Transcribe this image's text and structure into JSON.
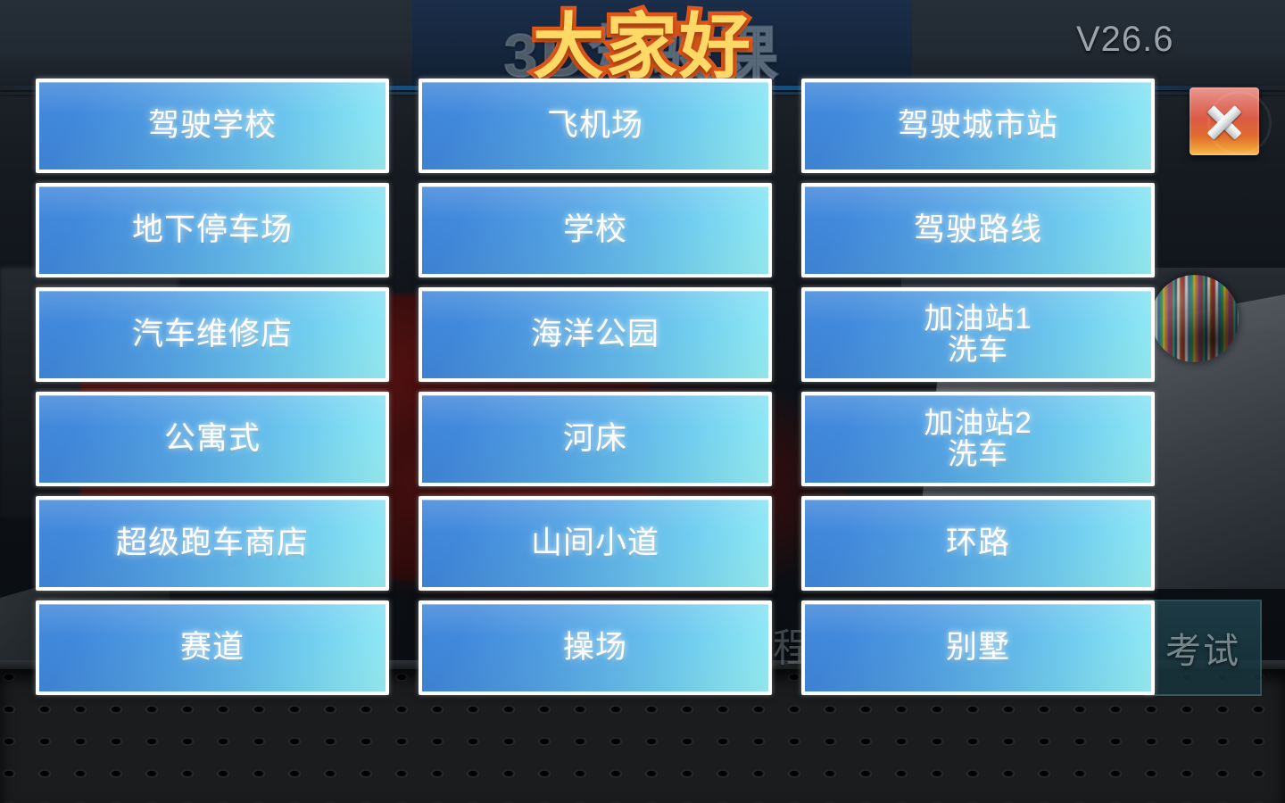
{
  "app": {
    "background_title": "3D驾驶课",
    "overlay_text": "大家好",
    "version": "V26.6"
  },
  "colors": {
    "button_gradient_start": "#3f86da",
    "button_gradient_end": "#9bf0f6",
    "button_border": "#ffffff",
    "overlay_text_fill": "#ffd966",
    "overlay_text_stroke": "#e2571b",
    "version_text": "#9aa3ab",
    "close_button_top": "#e8988f",
    "close_button_bottom": "#f6c05c",
    "background_dark": "#10141a"
  },
  "close_button": {
    "name": "close-icon",
    "label": "✕"
  },
  "background_elements": {
    "language_globe": "flag-globe-icon",
    "ghost_button_label": "考试",
    "ghost_char": "程"
  },
  "menu": {
    "columns": 3,
    "rows": 6,
    "buttons": [
      {
        "id": "driving-school",
        "label": "驾驶学校",
        "line2": "",
        "col": 1,
        "row": 1
      },
      {
        "id": "airport",
        "label": "飞机场",
        "line2": "",
        "col": 2,
        "row": 1
      },
      {
        "id": "driving-city-station",
        "label": "驾驶城市站",
        "line2": "",
        "col": 3,
        "row": 1
      },
      {
        "id": "underground-parking",
        "label": "地下停车场",
        "line2": "",
        "col": 1,
        "row": 2
      },
      {
        "id": "school",
        "label": "学校",
        "line2": "",
        "col": 2,
        "row": 2
      },
      {
        "id": "driving-route",
        "label": "驾驶路线",
        "line2": "",
        "col": 3,
        "row": 2
      },
      {
        "id": "auto-repair-shop",
        "label": "汽车维修店",
        "line2": "",
        "col": 1,
        "row": 3
      },
      {
        "id": "ocean-park",
        "label": "海洋公园",
        "line2": "",
        "col": 2,
        "row": 3
      },
      {
        "id": "gas-station-1",
        "label": "加油站1",
        "line2": "洗车",
        "col": 3,
        "row": 3
      },
      {
        "id": "apartment-style",
        "label": "公寓式",
        "line2": "",
        "col": 1,
        "row": 4
      },
      {
        "id": "riverbed",
        "label": "河床",
        "line2": "",
        "col": 2,
        "row": 4
      },
      {
        "id": "gas-station-2",
        "label": "加油站2",
        "line2": "洗车",
        "col": 3,
        "row": 4
      },
      {
        "id": "supercar-shop",
        "label": "超级跑车商店",
        "line2": "",
        "col": 1,
        "row": 5
      },
      {
        "id": "mountain-trail",
        "label": "山间小道",
        "line2": "",
        "col": 2,
        "row": 5
      },
      {
        "id": "ring-road",
        "label": "环路",
        "line2": "",
        "col": 3,
        "row": 5
      },
      {
        "id": "race-track",
        "label": "赛道",
        "line2": "",
        "col": 1,
        "row": 6
      },
      {
        "id": "playground",
        "label": "操场",
        "line2": "",
        "col": 2,
        "row": 6
      },
      {
        "id": "villa",
        "label": "别墅",
        "line2": "",
        "col": 3,
        "row": 6
      }
    ]
  }
}
